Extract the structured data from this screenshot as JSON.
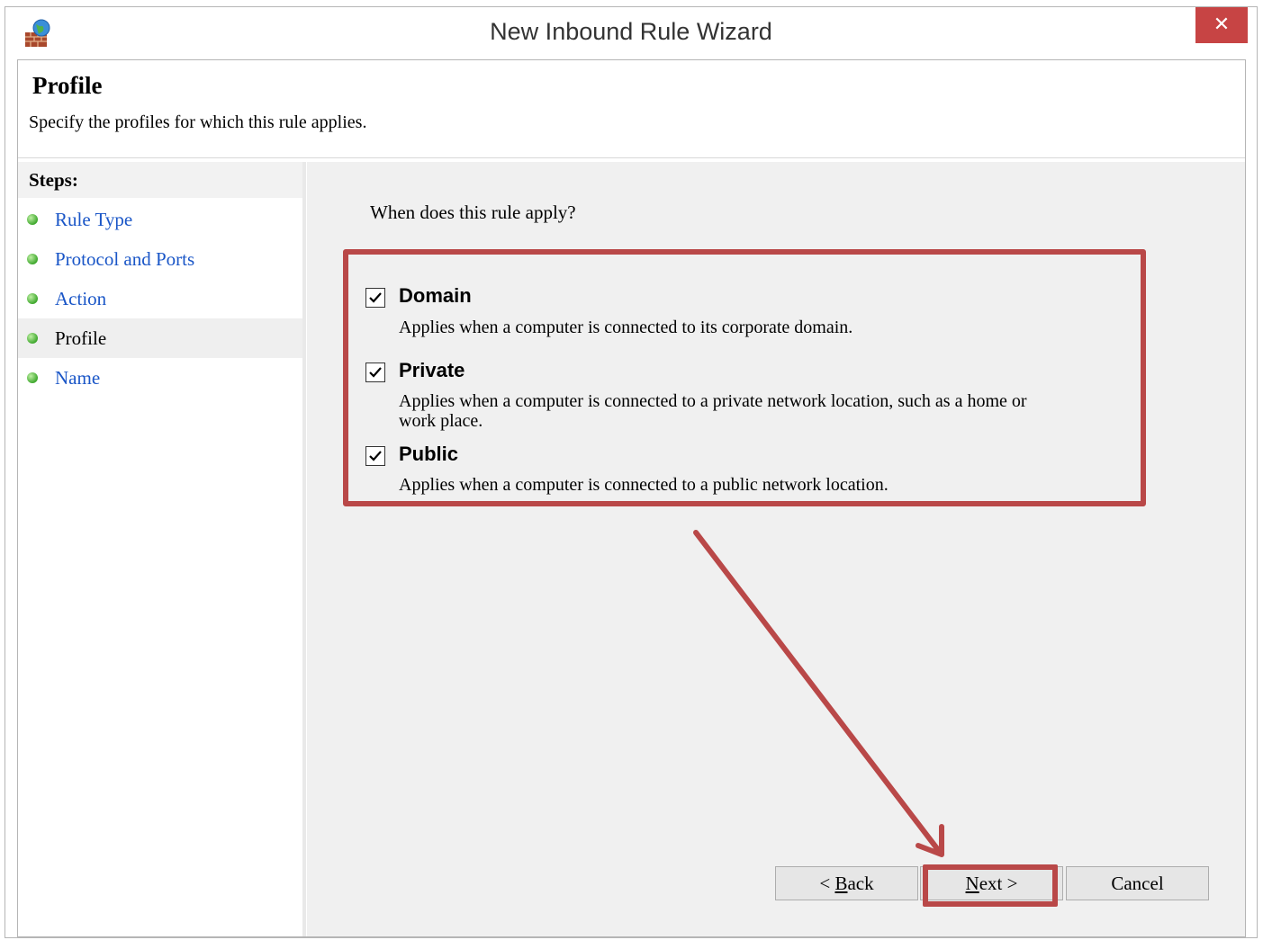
{
  "window": {
    "title": "New Inbound Rule Wizard",
    "close_glyph": "✕",
    "app_icon": "firewall-icon"
  },
  "header": {
    "title": "Profile",
    "subtitle": "Specify the profiles for which this rule applies."
  },
  "steps": {
    "heading": "Steps:",
    "items": [
      {
        "label": "Rule Type",
        "state": "link"
      },
      {
        "label": "Protocol and Ports",
        "state": "link"
      },
      {
        "label": "Action",
        "state": "link"
      },
      {
        "label": "Profile",
        "state": "current"
      },
      {
        "label": "Name",
        "state": "link"
      }
    ]
  },
  "main": {
    "question": "When does this rule apply?",
    "profiles": [
      {
        "label": "Domain",
        "checked": true,
        "description": "Applies when a computer is connected to its corporate domain."
      },
      {
        "label": "Private",
        "checked": true,
        "description_line1": "Applies when a computer is connected to a private network location, such as a home or",
        "description_line2": "work place."
      },
      {
        "label": "Public",
        "checked": true,
        "description": "Applies when a computer is connected to a public network location."
      }
    ]
  },
  "buttons": {
    "back_prefix": "< ",
    "back_key": "B",
    "back_rest": "ack",
    "next_key": "N",
    "next_rest": "ext >",
    "cancel": "Cancel"
  },
  "colors": {
    "annotation": "#b94848",
    "link": "#1a56c7",
    "close": "#c74444"
  }
}
